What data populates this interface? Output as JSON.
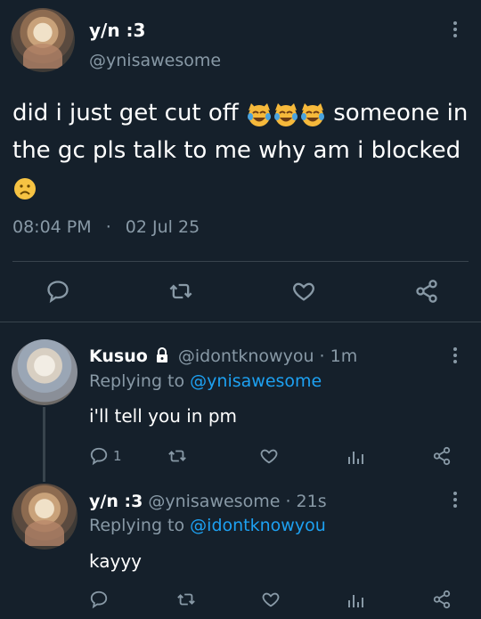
{
  "main_tweet": {
    "display_name": "y/n :3",
    "handle": "@ynisawesome",
    "text_part1": "did i just get cut off",
    "text_part2": "someone in",
    "text_line2": "the gc pls talk to me why am i blocked",
    "time": "08:04 PM",
    "separator": "·",
    "date": "02 Jul 25"
  },
  "reply1": {
    "display_name": "Kusuo",
    "handle": "@idontknowyou",
    "time_sep": "·",
    "time": "1m",
    "replying_prefix": "Replying to",
    "replying_to": "@ynisawesome",
    "text": "i'll tell you in pm",
    "reply_count": "1"
  },
  "reply2": {
    "display_name": "y/n :3",
    "handle": "@ynisawesome",
    "time_sep": "·",
    "time": "21s",
    "replying_prefix": "Replying to",
    "replying_to": "@idontknowyou",
    "text": "kayyy"
  },
  "colors": {
    "background": "#15202b",
    "muted": "#8899a6",
    "link": "#1da1f2",
    "divider": "#38444d"
  }
}
